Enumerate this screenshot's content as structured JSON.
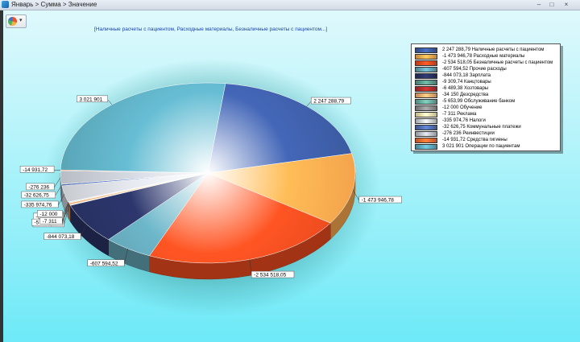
{
  "window": {
    "title": "Январь > Сумма > Значение",
    "minimize": "–",
    "maximize": "□",
    "close": "×"
  },
  "toolbar": {
    "chart_type_icon": "pie-chart-icon",
    "dropdown_icon": "chevron-down-icon",
    "dropdown_glyph": "▾"
  },
  "colors": {
    "background_top": "#dff9fc",
    "background_bottom": "#6de9f7",
    "title_text": "#1a3fb0"
  },
  "chart_data": {
    "type": "pie",
    "title": "[Наличные расчеты с пациентом, Расходные материалы, Безналичные расчеты с пациентом...]",
    "legend_position": "top-right",
    "slices": [
      {
        "label": "Наличные расчеты с пациентом",
        "value": 2247288.79,
        "display": "2 247 288,79",
        "color": "#3b5aa0"
      },
      {
        "label": "Расходные материалы",
        "value": -1473946.78,
        "display": "-1 473 946,78",
        "color": "#f4a44c"
      },
      {
        "label": "Безналичные расчеты с пациентом",
        "value": -2534518.05,
        "display": "-2 534 518,05",
        "color": "#e84a1e"
      },
      {
        "label": "Прочие расходы",
        "value": -607594.52,
        "display": "-607 594,52",
        "color": "#5f9fb0"
      },
      {
        "label": "Зарплата",
        "value": -844073.18,
        "display": "-844 073,18",
        "color": "#27305f"
      },
      {
        "label": "Канцтовары",
        "value": -9309.74,
        "display": "-9 309,74",
        "color": "#5a9688"
      },
      {
        "label": "Хозтовары",
        "value": -6489.38,
        "display": "-6 489,38",
        "color": "#b02a2a"
      },
      {
        "label": "Дезсредства",
        "value": -34150,
        "display": "-34 150",
        "color": "#f0a66a"
      },
      {
        "label": "Обслуживание банком",
        "value": -5653.99,
        "display": "-5 653,99",
        "color": "#67a89b"
      },
      {
        "label": "Обучение",
        "value": -12000,
        "display": "-12 000",
        "color": "#8a8a8a"
      },
      {
        "label": "Реклама",
        "value": -7311,
        "display": "-7 311",
        "color": "#f1e6a8"
      },
      {
        "label": "Налоги",
        "value": -335974.76,
        "display": "-335 974,76",
        "color": "#c7cbd0"
      },
      {
        "label": "Коммунальные платежи",
        "value": -32626.75,
        "display": "-32 626,75",
        "color": "#4f6cae"
      },
      {
        "label": "Реинвестиции",
        "value": -276236,
        "display": "-276 236",
        "color": "#b8bcc4"
      },
      {
        "label": "Средства гигиены",
        "value": -14931.72,
        "display": "-14 931,72",
        "color": "#e9682f"
      },
      {
        "label": "Операции по пациентам",
        "value": 3021901,
        "display": "3 021 901",
        "color": "#5aa5b8"
      }
    ]
  }
}
